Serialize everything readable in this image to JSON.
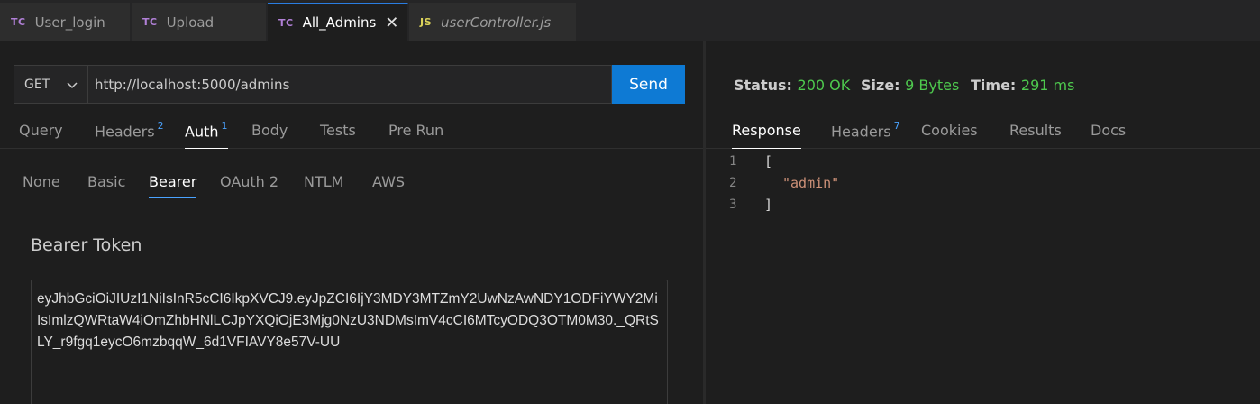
{
  "tabs": [
    {
      "icon": "TC",
      "label": "User_login"
    },
    {
      "icon": "TC",
      "label": "Upload"
    },
    {
      "icon": "TC",
      "label": "All_Admins",
      "close": "✕"
    },
    {
      "icon": "JS",
      "label": "userController.js"
    }
  ],
  "request": {
    "method": "GET",
    "url": "http://localhost:5000/admins",
    "send_label": "Send",
    "tabs": [
      {
        "label": "Query"
      },
      {
        "label": "Headers",
        "count": "2"
      },
      {
        "label": "Auth",
        "count": "1"
      },
      {
        "label": "Body"
      },
      {
        "label": "Tests"
      },
      {
        "label": "Pre Run"
      }
    ],
    "auth_tabs": [
      "None",
      "Basic",
      "Bearer",
      "OAuth 2",
      "NTLM",
      "AWS"
    ],
    "token_label": "Bearer Token",
    "token_value": "eyJhbGciOiJIUzI1NiIsInR5cCI6IkpXVCJ9.eyJpZCI6IjY3MDY3MTZmY2UwNzAwNDY1ODFiYWY2MiIsImlzQWRtaW4iOmZhbHNlLCJpYXQiOjE3Mjg0NzU3NDMsImV4cCI6MTcyODQ3OTM0M30._QRtSLY_r9fgq1eycO6mzbqqW_6d1VFIAVY8e57V-UU"
  },
  "response": {
    "status_label": "Status:",
    "status_value": "200 OK",
    "size_label": "Size:",
    "size_value": "9 Bytes",
    "time_label": "Time:",
    "time_value": "291 ms",
    "tabs": [
      {
        "label": "Response"
      },
      {
        "label": "Headers",
        "count": "7"
      },
      {
        "label": "Cookies"
      },
      {
        "label": "Results"
      },
      {
        "label": "Docs"
      }
    ],
    "lines": [
      {
        "n": "1",
        "text": "["
      },
      {
        "n": "2",
        "text": "\"admin\""
      },
      {
        "n": "3",
        "text": "]"
      }
    ]
  },
  "colors": {
    "accent": "#0e7ad4",
    "status_ok": "#4ec94e",
    "string": "#ce9178",
    "tc_icon": "#b180d7",
    "js_icon": "#dcd35a"
  }
}
